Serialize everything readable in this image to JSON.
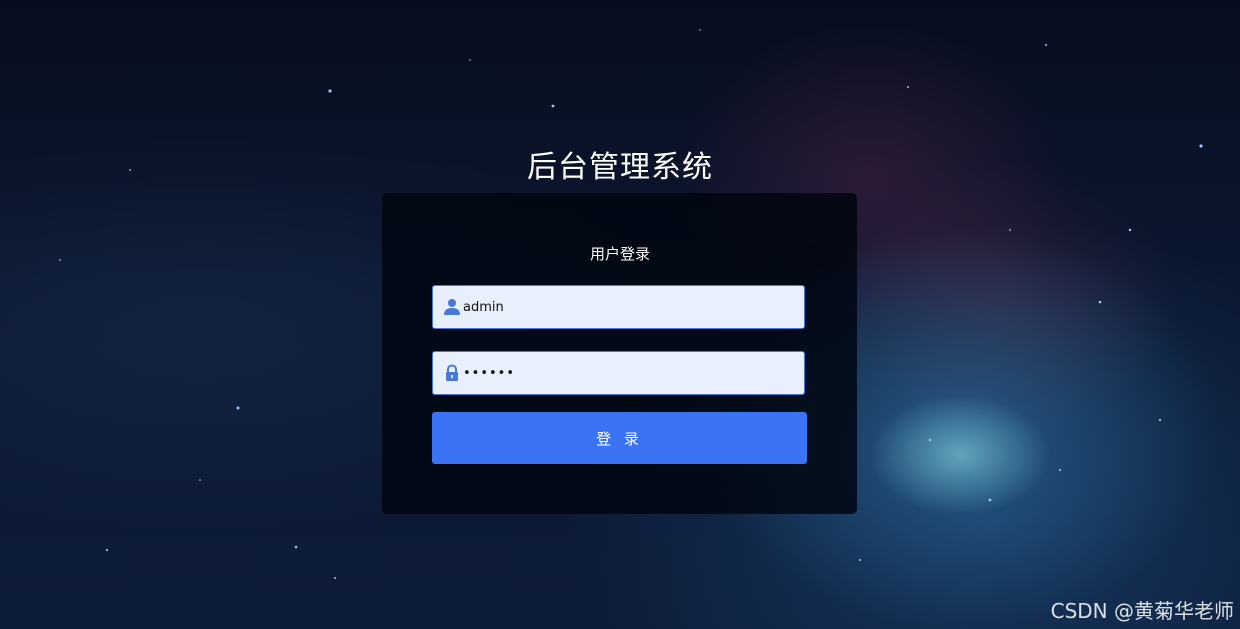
{
  "page": {
    "title": "后台管理系统"
  },
  "login": {
    "heading": "用户登录",
    "username": {
      "value": "admin",
      "icon": "user-icon"
    },
    "password": {
      "value": "••••••",
      "icon": "lock-icon"
    },
    "submit_label": "登 录"
  },
  "watermark": "CSDN @黄菊华老师",
  "colors": {
    "accent": "#3a74f5",
    "input_bg": "#e8f0fe",
    "icon": "#4a78d8"
  }
}
